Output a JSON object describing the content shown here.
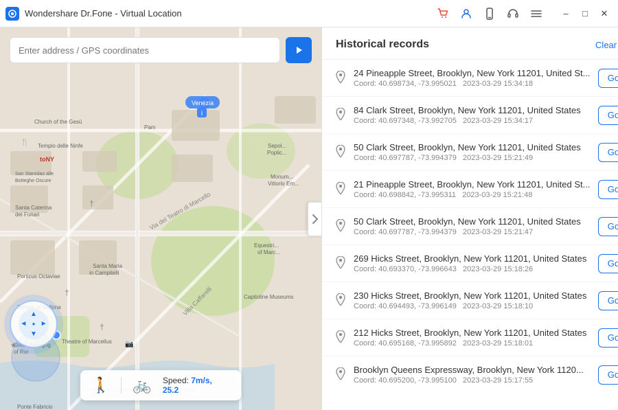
{
  "titleBar": {
    "appName": "Wondershare Dr.Fone - Virtual Location",
    "icons": [
      "cart-icon",
      "user-icon",
      "phone-icon",
      "headset-icon",
      "menu-icon"
    ]
  },
  "search": {
    "placeholder": "Enter address / GPS coordinates"
  },
  "speed": {
    "label": "Speed:",
    "value": "7m/s, 25.2"
  },
  "panel": {
    "title": "Historical records",
    "clearAll": "Clear All"
  },
  "records": [
    {
      "address": "24 Pineapple Street, Brooklyn, New York 11201, United St...",
      "coord": "Coord: 40.698734, -73.995021",
      "date": "2023-03-29 15:34:18",
      "goLabel": "Go"
    },
    {
      "address": "84 Clark Street, Brooklyn, New York 11201, United States",
      "coord": "Coord: 40.697348, -73.992705",
      "date": "2023-03-29 15:34:17",
      "goLabel": "Go"
    },
    {
      "address": "50 Clark Street, Brooklyn, New York 11201, United States",
      "coord": "Coord: 40.697787, -73.994379",
      "date": "2023-03-29 15:21:49",
      "goLabel": "Go"
    },
    {
      "address": "21 Pineapple Street, Brooklyn, New York 11201, United St...",
      "coord": "Coord: 40.698842, -73.995311",
      "date": "2023-03-29 15:21:48",
      "goLabel": "Go"
    },
    {
      "address": "50 Clark Street, Brooklyn, New York 11201, United States",
      "coord": "Coord: 40.697787, -73.994379",
      "date": "2023-03-29 15:21:47",
      "goLabel": "Go"
    },
    {
      "address": "269 Hicks Street, Brooklyn, New York 11201, United States",
      "coord": "Coord: 40.693370, -73.996643",
      "date": "2023-03-29 15:18:26",
      "goLabel": "Go"
    },
    {
      "address": "230 Hicks Street, Brooklyn, New York 11201, United States",
      "coord": "Coord: 40.694493, -73.996149",
      "date": "2023-03-29 15:18:10",
      "goLabel": "Go"
    },
    {
      "address": "212 Hicks Street, Brooklyn, New York 11201, United States",
      "coord": "Coord: 40.695168, -73.995892",
      "date": "2023-03-29 15:18:01",
      "goLabel": "Go"
    },
    {
      "address": "Brooklyn Queens Expressway, Brooklyn, New York 1120...",
      "coord": "Coord: 40.695200, -73.995100",
      "date": "2023-03-29 15:17:55",
      "goLabel": "Go"
    }
  ]
}
